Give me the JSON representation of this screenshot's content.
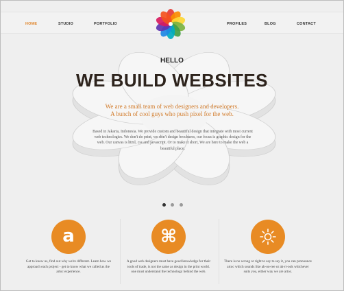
{
  "nav": {
    "left": [
      {
        "label": "HOME",
        "active": true
      },
      {
        "label": "STUDIO"
      },
      {
        "label": "PORTFOLIO"
      }
    ],
    "right": [
      {
        "label": "PROFILES"
      },
      {
        "label": "BLOG"
      },
      {
        "label": "CONTACT"
      }
    ]
  },
  "hero": {
    "hello": "HELLO",
    "headline": "WE BUILD WEBSITES",
    "tagline_line1": "We are a small team of web designers and developers.",
    "tagline_line2": "A bunch of cool guys who push pixel for the web.",
    "body": "Based in Jakarta, Indonesia. We provide custom and beautiful design that integrate with most current web technologies. We don't do print, we don't design brochures, our focus is graphic design for the web. Our canvas is html, css and javascript. Or to make it short, We are here to make the web a beautiful place."
  },
  "slider": {
    "dots": 3,
    "active_index": 0
  },
  "features": [
    {
      "icon": "letter-a-icon",
      "glyph": "a",
      "text": "Get to know us, find out why we're different. Learn how we approach each project - get to know what we called as the artoc experience."
    },
    {
      "icon": "command-key-icon",
      "glyph": "⌘",
      "text": "A good web designers must have good knowledge for their tools of trade, is not the same as design in the print world. one must understand the technology behind the web."
    },
    {
      "icon": "sun-icon",
      "glyph": "",
      "text": "There is no wrong or right to say to say it, you can pronounce artoc which sounds like ah-oo-ree or ah-rt-ook whichever suits you, either way we are artoc."
    }
  ],
  "colors": {
    "accent": "#e88b24",
    "active_nav": "#e0852b",
    "headline": "#2d231c",
    "tagline": "#d27b2a",
    "logo_petals": [
      "#e53935",
      "#fb8c00",
      "#fdd835",
      "#7cb342",
      "#43a047",
      "#00acc1",
      "#1e88e5",
      "#5e35b1",
      "#d81b60",
      "#f4511e"
    ]
  }
}
